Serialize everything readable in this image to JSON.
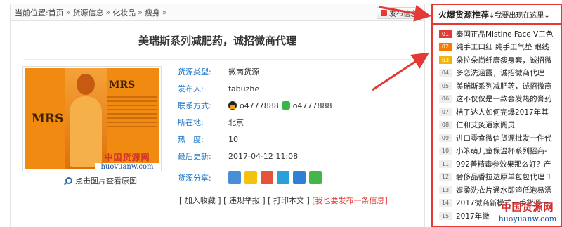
{
  "breadcrumb": {
    "prefix": "当前位置:",
    "items": [
      "首页",
      "货源信息",
      "化妆品",
      "瘦身"
    ],
    "separator": "»",
    "trailing": "»"
  },
  "post_button": {
    "label": "发布信息"
  },
  "title": "美瑞斯系列减肥药，诚招微商代理",
  "photo": {
    "logo_left": "MRS",
    "logo_right": "MRS",
    "watermark_cn": "中国货源网",
    "watermark_en": "huoyuanw.com"
  },
  "zoom_link": "点击图片查看原图",
  "info": {
    "rows": [
      {
        "key": "货源类型:",
        "value": "微商货源"
      },
      {
        "key": "发布人:",
        "value": "fabuzhe"
      },
      {
        "key": "联系方式:",
        "qq": "o4777888",
        "wechat": "o4777888"
      },
      {
        "key": "所在地:",
        "value": "北京"
      },
      {
        "key": "热　度:",
        "value": "10"
      },
      {
        "key": "最后更新:",
        "value": "2017-04-12 11:08"
      }
    ],
    "share_label": "货源分享:",
    "share_icons": [
      "plus-share-icon",
      "qzone-icon",
      "weibo-icon",
      "tencent-weibo-icon",
      "renren-icon",
      "wechat-icon"
    ]
  },
  "actions": {
    "add_favorite": "[ 加入收藏 ]",
    "report": "[ 违规举报 ]",
    "print": "[ 打印本文 ]",
    "post_new": "[我也要发布一条信息]"
  },
  "hot": {
    "title": "火爆货源推荐",
    "subtitle": "↓我要出现在这里↓",
    "items": [
      {
        "num": "01",
        "text": "泰国正品Mistine Face V三色"
      },
      {
        "num": "02",
        "text": "纯手工口红 纯手工气垫 眼线"
      },
      {
        "num": "03",
        "text": "朵拉朵尚纤康瘦身套，诚招微"
      },
      {
        "num": "04",
        "text": "多恋洗涵露，诚招微商代理"
      },
      {
        "num": "05",
        "text": "美瑞斯系列减肥药，诚招微商"
      },
      {
        "num": "06",
        "text": "这不仅仅是一款会发热的膏药"
      },
      {
        "num": "07",
        "text": "桔子达人如何完爆2017年其"
      },
      {
        "num": "08",
        "text": "仁和艾灸道家阁灵"
      },
      {
        "num": "09",
        "text": "进口零食微信货源批发一件代"
      },
      {
        "num": "10",
        "text": "小笨萌儿童保温杯系列招商-"
      },
      {
        "num": "11",
        "text": "992善精毒参效果那么好？产"
      },
      {
        "num": "12",
        "text": "奢侈品香拉达原单包包代理 1"
      },
      {
        "num": "13",
        "text": "媞柔洗衣片通水即溶低泡易漂"
      },
      {
        "num": "14",
        "text": "2017微商新模式一手货源一"
      },
      {
        "num": "15",
        "text": "2017年微"
      }
    ]
  },
  "site_watermark": {
    "cn": "中国货源网",
    "en": "huoyuanw.com"
  },
  "colors": {
    "accent_red": "#e53935",
    "link_blue": "#1a73c8"
  }
}
